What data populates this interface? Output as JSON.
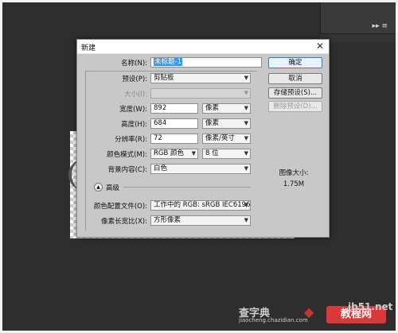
{
  "dialog": {
    "title": "新建",
    "close_icon": "close-icon"
  },
  "form": {
    "name_label": "名称(N):",
    "name_value": "未标题-1",
    "preset_label": "预设(P):",
    "preset_value": "剪贴板",
    "size_label": "大小(I):",
    "size_value": "",
    "width_label": "宽度(W):",
    "width_value": "892",
    "width_unit": "像素",
    "height_label": "高度(H):",
    "height_value": "684",
    "height_unit": "像素",
    "resolution_label": "分辨率(R):",
    "resolution_value": "72",
    "resolution_unit": "像素/英寸",
    "color_mode_label": "颜色模式(M):",
    "color_mode_value": "RGB 颜色",
    "bit_depth_value": "8 位",
    "background_label": "背景内容(C):",
    "background_value": "白色",
    "advanced_label": "高级",
    "color_profile_label": "颜色配置文件(O):",
    "color_profile_value": "工作中的 RGB: sRGB IEC6196...",
    "pixel_aspect_label": "像素长宽比(X):",
    "pixel_aspect_value": "方形像素"
  },
  "buttons": {
    "ok": "确定",
    "cancel": "取消",
    "save_preset": "存储预设(S)...",
    "delete_preset": "删除预设(D)..."
  },
  "image_size": {
    "label": "图像大小:",
    "value": "1.75M"
  },
  "watermark": {
    "text_cn": "查字典",
    "badge": "教程网",
    "domain": "jiaocheng.chazidian.com",
    "site": "jb51.net"
  },
  "colors": {
    "background": "#2b2b2b",
    "dialog_body": "#c8c8c8",
    "selection": "#3399ff",
    "primary_border": "#3c7fb1"
  }
}
